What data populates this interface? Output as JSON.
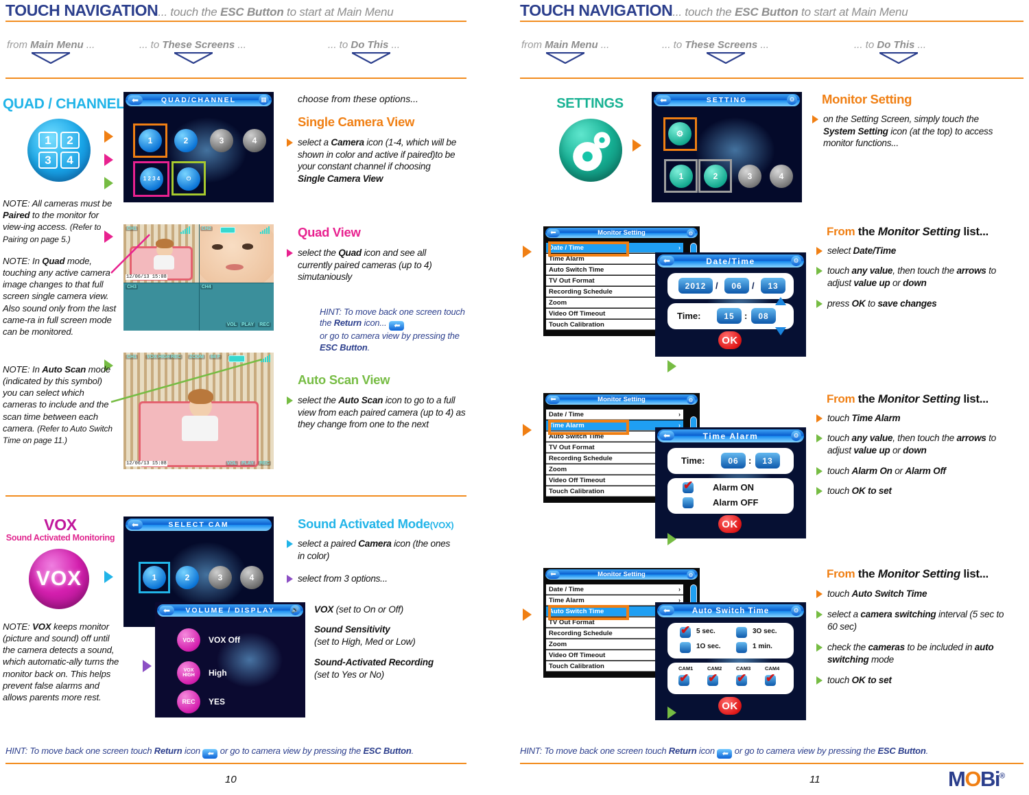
{
  "header": {
    "title_main": "TOUCH NAVIGATION",
    "title_sub_a": "... touch the ",
    "title_sub_b": "ESC Button",
    "title_sub_c": " to start at Main Menu",
    "col1_a": "from ",
    "col1_b": "Main Menu",
    "col1_c": " ...",
    "col2_a": "... to ",
    "col2_b": "These Screens",
    "col2_c": " ...",
    "col3_a": "... to ",
    "col3_b": "Do This",
    "col3_c": " ..."
  },
  "colors": {
    "orange": "#f07f13",
    "pink": "#e8218f",
    "green": "#76bc43",
    "cyan": "#21b4e8",
    "blue": "#2b3e8c",
    "teal": "#18b293",
    "rule": "#f28c1e",
    "magenta": "#c0179b"
  },
  "left_page": {
    "quad": {
      "label": "QUAD / CHANNEL",
      "icon_cells": [
        "1",
        "2",
        "3",
        "4"
      ],
      "notes": [
        {
          "parts": [
            "NOTE:  All cameras must be ",
            "Paired",
            " to the monitor for view-ing access. "
          ],
          "tail": "(Refer to Pairing on page 5.)"
        },
        {
          "parts": [
            "NOTE:  In ",
            "Quad",
            " mode, touching any active camera image changes to that full screen single camera view. Also sound only from the last came-ra in full screen mode can be monitored."
          ],
          "tail": ""
        },
        {
          "parts": [
            "NOTE:  In ",
            "Auto Scan",
            " mode (indicated by this symbol) you can select which cameras to include and the scan time between each camera. "
          ],
          "tail": "(Refer to Auto Switch Time on page 11.)"
        }
      ],
      "screen_title": "QUAD/CHANNEL",
      "cams": [
        "1",
        "2",
        "3",
        "4"
      ],
      "quad_icon_label": "1 2 3 4",
      "auto_icon_label": "AUTO",
      "lead": "choose from these options...",
      "opt1_title": "Single Camera View",
      "opt1_body_1": "select a ",
      "opt1_body_2": "Camera",
      "opt1_body_3": " icon (1-4, which will be shown in color and active if paired)to be your constant channel if choosing ",
      "opt1_body_4": "Single Camera View",
      "opt2_title": "Quad View",
      "opt2_body_1": "select the ",
      "opt2_body_2": "Quad",
      "opt2_body_3": " icon and see all currently paired cameras (up to 4) simutaniously",
      "hint_1": "HINT: To move back one screen touch the ",
      "hint_2": "Return",
      "hint_3": " icon... ",
      "hint_4": "or go to camera view by pressing the ",
      "hint_5": "ESC Button",
      "hint_6": ".",
      "opt3_title": "Auto Scan View",
      "opt3_body_1": "select the ",
      "opt3_body_2": "Auto Scan",
      "opt3_body_3": " icon to go to a full view from each  paired camera (up to 4) as they change from one to the next",
      "quad_timestamp": "12/06/13 15:08",
      "quad_cam_labels": [
        "CH1",
        "CH2",
        "CH3",
        "CH4"
      ],
      "autoscan_osd": [
        "CH1",
        "VOX HIGH",
        "REC",
        "ZOOM",
        "68 F"
      ],
      "footer_icons": [
        "VOL",
        "PLAY",
        "REC"
      ]
    },
    "vox": {
      "label": "VOX",
      "sublabel": "Sound Activated Monitoring",
      "icon_text": "VOX",
      "note_1": "NOTE: ",
      "note_2": "VOX",
      "note_3": " keeps monitor (picture and sound) off until the camera detects a sound, which automatic-ally turns the monitor back on. This helps prevent false alarms and allows parents more rest.",
      "screen_title": "SELECT CAM",
      "cams": [
        "1",
        "2",
        "3",
        "4"
      ],
      "dialog_title": "VOLUME / DISPLAY",
      "dialog_rows": [
        {
          "icon": "VOX",
          "value": "VOX Off"
        },
        {
          "icon": "VOX HIGH",
          "value": "High"
        },
        {
          "icon": "REC",
          "value": "YES"
        }
      ],
      "opt_title_main": "Sound Activated Mode",
      "opt_title_sub": "(VOX)",
      "b1_1": "select a paired ",
      "b1_2": "Camera",
      "b1_3": " icon (the ones in color)",
      "b2": "select from 3 options...",
      "d1_1": "VOX",
      "d1_2": " (set to On or Off)",
      "d2_1": "Sound Sensitivity",
      "d2_2": "(set to High, Med or Low)",
      "d3_1": "Sound-Activated Recording",
      "d3_2": "(set to Yes or No)"
    },
    "footer": {
      "hint_1": "HINT: To move back one screen touch ",
      "hint_2": "Return",
      "hint_3": " icon ",
      "hint_4": " or go to camera view by pressing the ",
      "hint_5": "ESC Button",
      "hint_6": ".",
      "page": "10"
    }
  },
  "right_page": {
    "settings": {
      "label": "SETTINGS",
      "screen_title": "SETTING",
      "cams": [
        "1",
        "2",
        "3",
        "4"
      ],
      "opt_title": "Monitor Setting",
      "b1_1": "on the Setting Screen, simply touch the ",
      "b1_2": "System Setting",
      "b1_3": " icon (at the top) to access monitor functions..."
    },
    "monitor_list": {
      "bar_title": "Monitor Setting",
      "rows": [
        "Date / Time",
        "Time Alarm",
        "Auto Switch Time",
        "TV Out Format",
        "Recording Schedule",
        "Zoom",
        "Video Off Timeout",
        "Touch Calibration"
      ]
    },
    "blocks": [
      {
        "selected_row": "Date / Time",
        "dialog_title": "Date/Time",
        "date": {
          "year": "2012",
          "month": "06",
          "day": "13"
        },
        "time_label": "Time:",
        "time": {
          "hh": "15",
          "mm": "08"
        },
        "ok": "OK",
        "heading_1": "From",
        "heading_2": " the ",
        "heading_3": "Monitor Setting",
        "heading_4": " list...",
        "bullets": [
          [
            {
              "t": "select ",
              "b": false
            },
            {
              "t": "Date/Time",
              "b": true
            }
          ],
          [
            {
              "t": "touch ",
              "b": false
            },
            {
              "t": "any value",
              "b": true
            },
            {
              "t": ", then touch the ",
              "b": false
            },
            {
              "t": "arrows",
              "b": true
            },
            {
              "t": " to adjust ",
              "b": false
            },
            {
              "t": "value up",
              "b": true
            },
            {
              "t": " or ",
              "b": false
            },
            {
              "t": "down",
              "b": true
            }
          ],
          [
            {
              "t": "press ",
              "b": false
            },
            {
              "t": "OK",
              "b": true
            },
            {
              "t": " to ",
              "b": false
            },
            {
              "t": "save changes",
              "b": true
            }
          ]
        ]
      },
      {
        "selected_row": "Time Alarm",
        "dialog_title": "Time Alarm",
        "time_label": "Time:",
        "time": {
          "hh": "06",
          "mm": "13"
        },
        "alarm_on": "Alarm ON",
        "alarm_off": "Alarm OFF",
        "ok": "OK",
        "heading_1": "From",
        "heading_2": " the ",
        "heading_3": "Monitor Setting",
        "heading_4": " list...",
        "bullets": [
          [
            {
              "t": "touch ",
              "b": false
            },
            {
              "t": "Time Alarm",
              "b": true
            }
          ],
          [
            {
              "t": "touch ",
              "b": false
            },
            {
              "t": "any value",
              "b": true
            },
            {
              "t": ", then touch the ",
              "b": false
            },
            {
              "t": "arrows",
              "b": true
            },
            {
              "t": " to adjust ",
              "b": false
            },
            {
              "t": "value up",
              "b": true
            },
            {
              "t": " or ",
              "b": false
            },
            {
              "t": "down",
              "b": true
            }
          ],
          [
            {
              "t": "touch ",
              "b": false
            },
            {
              "t": "Alarm On",
              "b": true
            },
            {
              "t": " or ",
              "b": false
            },
            {
              "t": "Alarm Off",
              "b": true
            }
          ],
          [
            {
              "t": "touch ",
              "b": false
            },
            {
              "t": "OK to set",
              "b": true
            }
          ]
        ]
      },
      {
        "selected_row": "Auto Switch Time",
        "dialog_title": "Auto Switch Time",
        "intervals": [
          {
            "label": "5 sec.",
            "checked": true
          },
          {
            "label": "3O sec.",
            "checked": false
          },
          {
            "label": "1O sec.",
            "checked": false
          },
          {
            "label": "1 min.",
            "checked": false
          }
        ],
        "cam_labels": [
          "CAM1",
          "CAM2",
          "CAM3",
          "CAM4"
        ],
        "cam_checked": [
          true,
          true,
          true,
          true
        ],
        "ok": "OK",
        "heading_1": "From",
        "heading_2": " the ",
        "heading_3": "Monitor Setting",
        "heading_4": " list...",
        "bullets": [
          [
            {
              "t": "touch ",
              "b": false
            },
            {
              "t": "Auto Switch Time",
              "b": true
            }
          ],
          [
            {
              "t": "select a ",
              "b": false
            },
            {
              "t": "camera switching",
              "b": true
            },
            {
              "t": " interval (5 sec to 60 sec)",
              "b": false
            }
          ],
          [
            {
              "t": "check the ",
              "b": false
            },
            {
              "t": "cameras",
              "b": true
            },
            {
              "t": " to be included in ",
              "b": false
            },
            {
              "t": "auto switching",
              "b": true
            },
            {
              "t": " mode",
              "b": false
            }
          ],
          [
            {
              "t": "touch ",
              "b": false
            },
            {
              "t": "OK to set",
              "b": true
            }
          ]
        ]
      }
    ],
    "footer": {
      "hint_1": "HINT: To move back one screen touch ",
      "hint_2": "Return",
      "hint_3": " icon ",
      "hint_4": " or go to camera view by pressing the ",
      "hint_5": "ESC Button",
      "hint_6": ".",
      "page": "11",
      "brand_m": "M",
      "brand_o": "O",
      "brand_bi": "Bi",
      "brand_reg": "®"
    }
  }
}
